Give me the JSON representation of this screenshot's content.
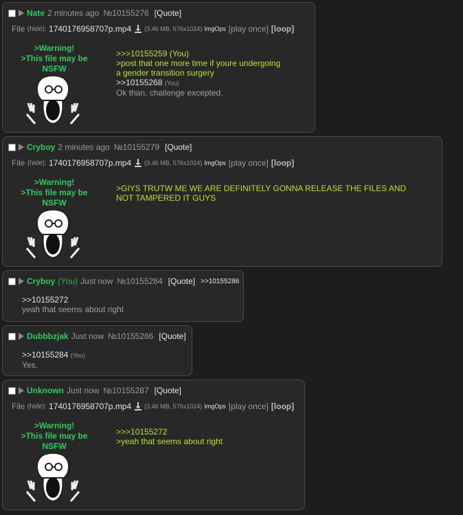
{
  "posts": [
    {
      "name": "Nate",
      "time": "2 minutes ago",
      "no": "№10155276",
      "quote": "[Quote]",
      "file": {
        "label": "File",
        "hide": "(hide):",
        "name": "1740176958707p.mp4",
        "size": "(3.46 MB, 576x1024)",
        "imgops": "ImgOps",
        "play": "[play once]",
        "loop": "[loop]"
      },
      "warning": [
        ">Warning!",
        ">This file may be",
        "NSFW"
      ],
      "lines": [
        ">>>10155259 (You)",
        ">post that one more time if youre undergoing",
        "a gender transition surgery",
        ">>10155268",
        "(You)",
        "Ok than, challenge excepted."
      ]
    },
    {
      "name": "Cryboy",
      "time": "2 minutes ago",
      "no": "№10155279",
      "quote": "[Quote]",
      "file": {
        "label": "File",
        "hide": "(hide):",
        "name": "1740176958707p.mp4",
        "size": "(3.46 MB, 576x1024)",
        "imgops": "ImgOps",
        "play": "[play once]",
        "loop": "[loop]"
      },
      "warning": [
        ">Warning!",
        ">This file may be",
        "NSFW"
      ],
      "lines": [
        ">GIYS TRUTW ME WE ARE DEFINITELY GONNA RELEASE THE FILES AND",
        "NOT TAMPERED IT GUYS"
      ]
    },
    {
      "name": "Cryboy",
      "you": "(You)",
      "time": "Just now",
      "no": "№10155284",
      "quote": "[Quote]",
      "backlink": ">>10155286",
      "lines": [
        ">>10155272",
        "yeah that seems about right"
      ]
    },
    {
      "name": "Dubbbzjak",
      "time": "Just now",
      "no": "№10155286",
      "quote": "[Quote]",
      "lines": [
        ">>10155284",
        "(You)",
        "Yes."
      ]
    },
    {
      "name": "Unknown",
      "time": "Just now",
      "no": "№10155287",
      "quote": "[Quote]",
      "file": {
        "label": "File",
        "hide": "(hide):",
        "name": "1740176958707p.mp4",
        "size": "(3.46 MB, 576x1024)",
        "imgops": "ImgOps",
        "play": "[play once]",
        "loop": "[loop]"
      },
      "warning": [
        ">Warning!",
        ">This file may be",
        "NSFW"
      ],
      "lines": [
        ">>>10155272",
        ">yeah that seems about right"
      ]
    }
  ]
}
